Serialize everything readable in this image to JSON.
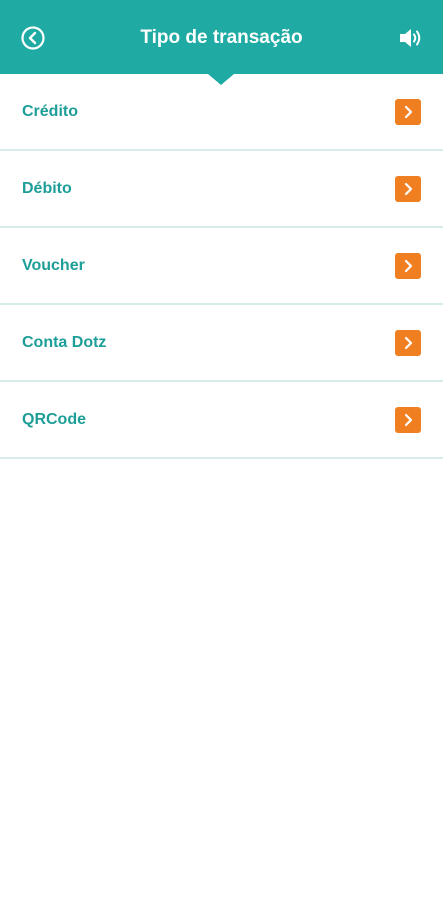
{
  "header": {
    "title": "Tipo de transação",
    "back_icon": "circle-chevron-left-icon",
    "sound_icon": "speaker-volume-icon",
    "color": "#1faba3"
  },
  "transaction_types": [
    {
      "label": "Crédito"
    },
    {
      "label": "Débito"
    },
    {
      "label": "Voucher"
    },
    {
      "label": "Conta Dotz"
    },
    {
      "label": "QRCode"
    }
  ],
  "colors": {
    "accent": "#f07f22",
    "label": "#1e9e98",
    "divider": "#d6ecea"
  }
}
